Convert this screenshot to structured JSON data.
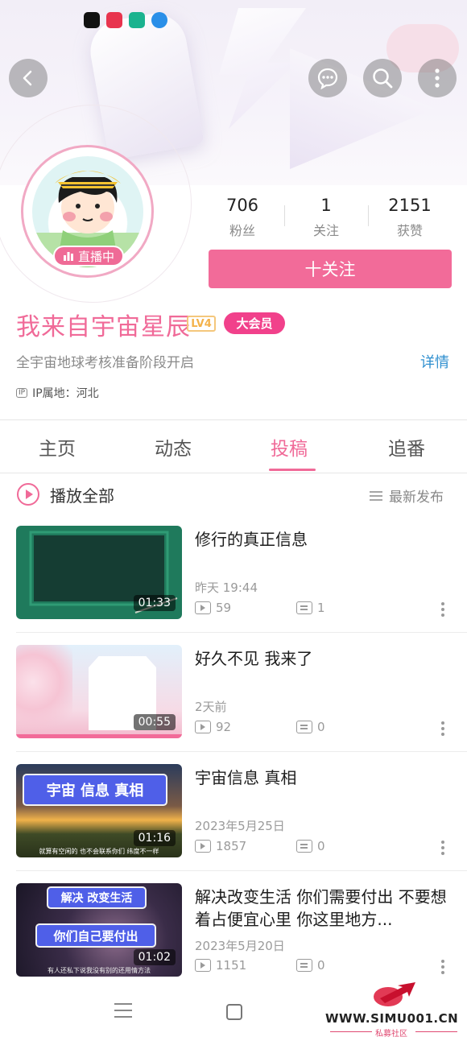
{
  "header": {
    "back_icon": "chevron-left-icon",
    "actions": [
      "message-icon",
      "search-icon",
      "more-vertical-icon"
    ]
  },
  "profile": {
    "live_label": "直播中",
    "stats": [
      {
        "value": "706",
        "label": "粉丝"
      },
      {
        "value": "1",
        "label": "关注"
      },
      {
        "value": "2151",
        "label": "获赞"
      }
    ],
    "follow_label": "十关注",
    "name": "我来自宇宙星辰",
    "level": "LV4",
    "vip": "大会员",
    "bio": "全宇宙地球考核准备阶段开启",
    "detail_label": "详情",
    "ip_badge": "IP",
    "ip": "IP属地：河北"
  },
  "tabs": [
    {
      "label": "主页",
      "active": false
    },
    {
      "label": "动态",
      "active": false
    },
    {
      "label": "投稿",
      "active": true
    },
    {
      "label": "追番",
      "active": false
    }
  ],
  "list_header": {
    "play_all": "播放全部",
    "sort": "最新发布"
  },
  "videos": [
    {
      "title": "修行的真正信息",
      "date": "昨天 19:44",
      "plays": "59",
      "comments": "1",
      "duration": "01:33"
    },
    {
      "title": "好久不见 我来了",
      "date": "2天前",
      "plays": "92",
      "comments": "0",
      "duration": "00:55"
    },
    {
      "title": "宇宙信息 真相",
      "date": "2023年5月25日",
      "plays": "1857",
      "comments": "0",
      "duration": "01:16",
      "thumb_text": "宇宙 信息 真相",
      "thumb_caption": "就算有空闲的 也不会联系你们 纬度不一样"
    },
    {
      "title": "解决改变生活 你们需要付出 不要想着占便宜心里 你这里地方...",
      "date": "2023年5月20日",
      "plays": "1151",
      "comments": "0",
      "duration": "01:02",
      "thumb_text_1": "解决 改变生活",
      "thumb_text_2": "你们自己要付出",
      "thumb_caption": "有人还私下说我没有别的还用情方法"
    }
  ],
  "watermark": {
    "text": "WWW.SIMU001.CN",
    "sub": "私募社区"
  }
}
